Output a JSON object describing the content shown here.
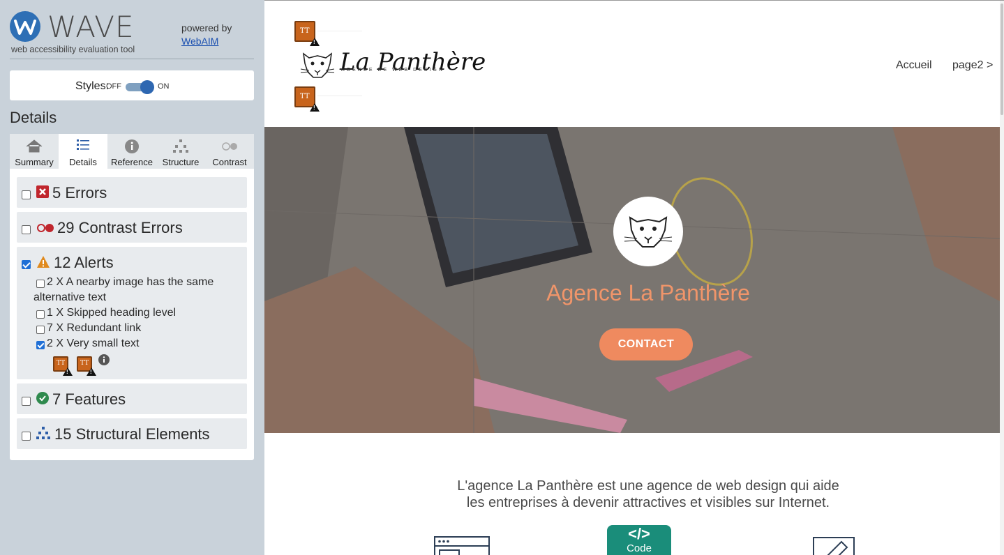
{
  "wave": {
    "title": "WAVE",
    "subtitle": "web accessibility evaluation tool",
    "powered_by": "powered by",
    "webaim_link": "WebAIM",
    "styles_label": "Styles:",
    "styles_off": "OFF",
    "styles_on": "ON",
    "details_heading": "Details",
    "tabs": [
      {
        "label": "Summary",
        "icon": "home-icon"
      },
      {
        "label": "Details",
        "icon": "list-icon",
        "active": true
      },
      {
        "label": "Reference",
        "icon": "info-icon"
      },
      {
        "label": "Structure",
        "icon": "structure-icon"
      },
      {
        "label": "Contrast",
        "icon": "contrast-icon"
      }
    ],
    "sections": [
      {
        "label": "5 Errors",
        "checked": false,
        "icon": "error-icon"
      },
      {
        "label": "29 Contrast Errors",
        "checked": false,
        "icon": "contrast-error-icon"
      },
      {
        "label": "12 Alerts",
        "checked": true,
        "icon": "alert-icon"
      },
      {
        "label": "7 Features",
        "checked": false,
        "icon": "feature-icon"
      },
      {
        "label": "15 Structural Elements",
        "checked": false,
        "icon": "structure-icon"
      }
    ],
    "alerts": [
      {
        "label_line1": "2 X A nearby image has the same",
        "label_line2": "alternative text",
        "checked": false
      },
      {
        "label": "1 X Skipped heading level",
        "checked": false
      },
      {
        "label": "7 X Redundant link",
        "checked": false
      },
      {
        "label": "2 X Very small text",
        "checked": true
      }
    ],
    "tt_icon_text": "TT"
  },
  "site": {
    "logo_text": "La Panthère",
    "logo_tagline": "AGENCE DE WEB DESIGN",
    "nav": [
      "Accueil",
      "page2 >"
    ],
    "hero_title": "Agence La Panthère",
    "hero_button": "CONTACT",
    "intro_line1": "L'agence La Panthère est une agence de web design qui aide",
    "intro_line2": "les entreprises à devenir attractives et visibles sur Internet.",
    "code_badge_symbol": "</>",
    "code_badge_label": "Code"
  },
  "colors": {
    "wave_bg": "#c9d2da",
    "accent_orange": "#ef8a5f",
    "hero_title": "#f0956a",
    "code_teal": "#1a8d7a"
  }
}
